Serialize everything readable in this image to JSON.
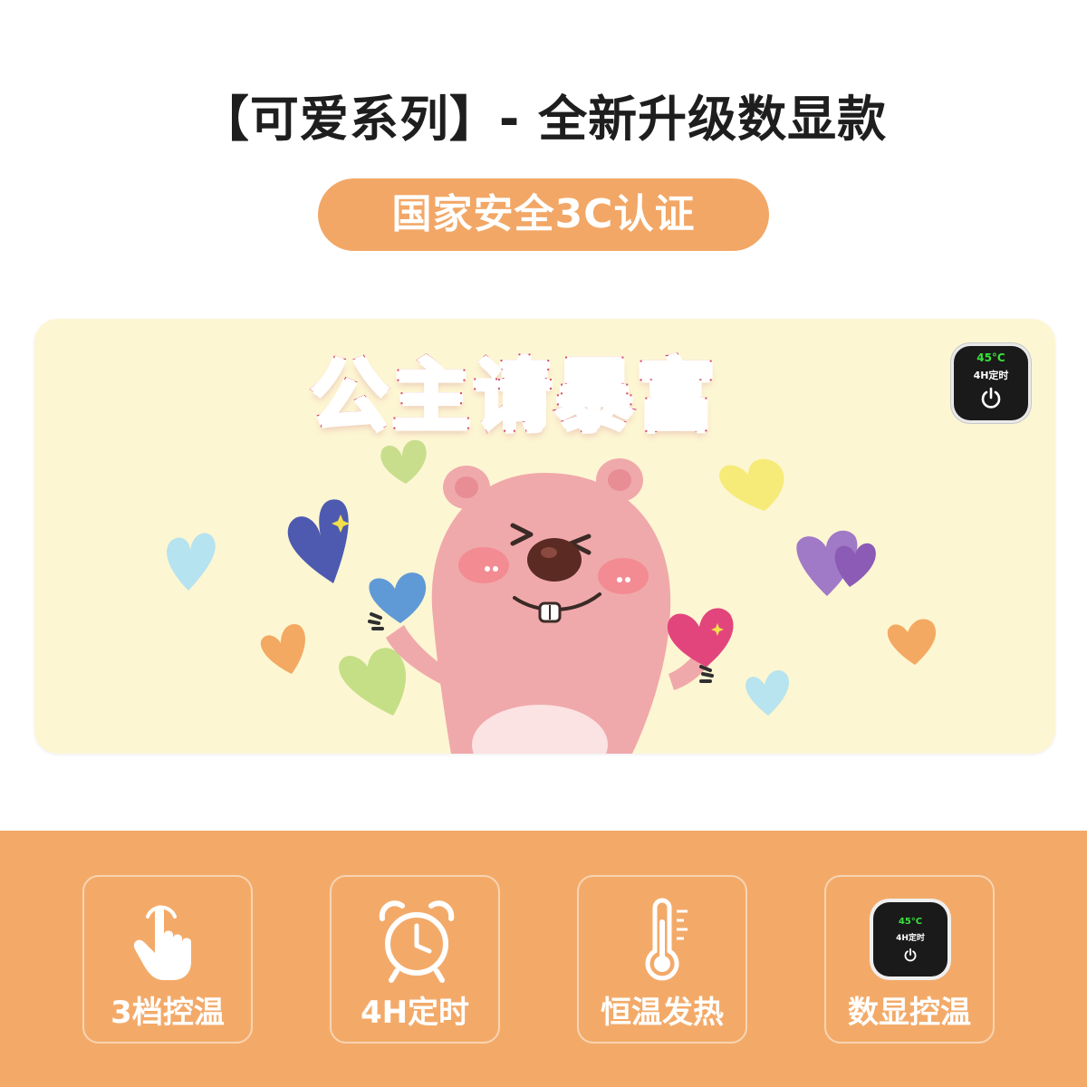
{
  "header": {
    "title": "【可爱系列】- 全新升级数显款",
    "certification": "国家安全3C认证"
  },
  "product": {
    "slogan": "公主请暴富",
    "controller": {
      "temperature": "45°C",
      "timer": "4H定时",
      "icon": "power-icon"
    }
  },
  "features": [
    {
      "label": "3档控温",
      "icon": "tap-hand-icon"
    },
    {
      "label": "4H定时",
      "icon": "alarm-clock-icon"
    },
    {
      "label": "恒温发热",
      "icon": "thermometer-icon"
    },
    {
      "label": "数显控温",
      "icon": "digital-controller-icon"
    }
  ],
  "feature_controller": {
    "temperature": "45°C",
    "timer": "4H定时"
  },
  "colors": {
    "accent": "#f3aa69",
    "mat_background": "#fdf6d3",
    "slogan_outline": "#d6476d",
    "display_green": "#39e23b"
  }
}
